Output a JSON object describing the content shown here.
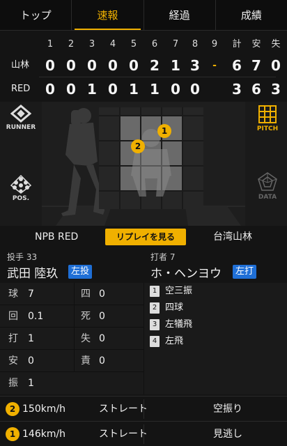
{
  "tabs": [
    {
      "label": "トップ"
    },
    {
      "label": "速報"
    },
    {
      "label": "経過"
    },
    {
      "label": "成績"
    }
  ],
  "scoreboard": {
    "innings": [
      "1",
      "2",
      "3",
      "4",
      "5",
      "6",
      "7",
      "8",
      "9"
    ],
    "totals_headers": [
      "計",
      "安",
      "失"
    ],
    "teams": [
      {
        "name": "山林",
        "runs": [
          "0",
          "0",
          "0",
          "0",
          "0",
          "2",
          "1",
          "3",
          "-"
        ],
        "totals": [
          "6",
          "7",
          "0"
        ]
      },
      {
        "name": "RED",
        "runs": [
          "0",
          "0",
          "1",
          "0",
          "1",
          "1",
          "0",
          "0",
          ""
        ],
        "totals": [
          "3",
          "6",
          "3"
        ]
      }
    ]
  },
  "pitch_view": {
    "runner_label": "RUNNER",
    "pos_label": "POS.",
    "pitch_label": "PITCH",
    "data_label": "DATA",
    "pitch_markers": [
      "1",
      "2"
    ]
  },
  "replay_bar": {
    "home_team": "NPB RED",
    "replay_label": "リプレイを見る",
    "away_team": "台湾山林"
  },
  "pitcher": {
    "role": "投手",
    "number": "33",
    "name": "武田 陸玖",
    "hand": "左投"
  },
  "batter": {
    "role": "打者",
    "number": "7",
    "name": "ホ・ヘンヨウ",
    "hand": "左打"
  },
  "stats": [
    {
      "k": "球",
      "v": "7",
      "k2": "四",
      "v2": "0"
    },
    {
      "k": "回",
      "v": "0.1",
      "k2": "死",
      "v2": "0"
    },
    {
      "k": "打",
      "v": "1",
      "k2": "失",
      "v2": "0"
    },
    {
      "k": "安",
      "v": "0",
      "k2": "責",
      "v2": "0"
    },
    {
      "k": "振",
      "v": "1",
      "k2": "",
      "v2": ""
    }
  ],
  "at_bat_results": [
    {
      "num": "1",
      "text": "空三振"
    },
    {
      "num": "2",
      "text": "四球"
    },
    {
      "num": "3",
      "text": "左犠飛"
    },
    {
      "num": "4",
      "text": "左飛"
    }
  ],
  "pitch_log": [
    {
      "num": "2",
      "speed": "150km/h",
      "type": "ストレート",
      "result": "空振り"
    },
    {
      "num": "1",
      "speed": "146km/h",
      "type": "ストレート",
      "result": "見逃し"
    }
  ],
  "colors": {
    "accent": "#f0b000",
    "hand_badge": "#1f6fd6"
  }
}
